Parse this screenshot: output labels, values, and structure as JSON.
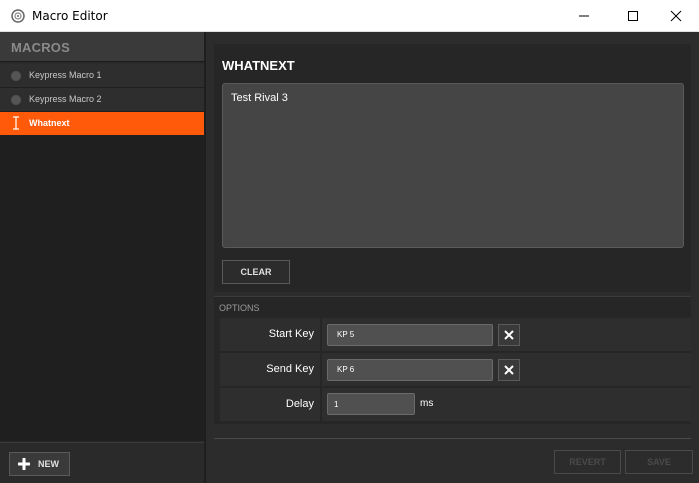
{
  "window": {
    "title": "Macro Editor"
  },
  "sidebar": {
    "header": "MACROS",
    "items": [
      {
        "label": "Keypress Macro 1",
        "active": false
      },
      {
        "label": "Keypress Macro 2",
        "active": false
      },
      {
        "label": "Whatnext",
        "active": true
      }
    ],
    "new_button": "NEW"
  },
  "editor": {
    "title": "WHATNEXT",
    "content": "Test Rival 3",
    "clear_button": "CLEAR"
  },
  "options": {
    "label": "OPTIONS",
    "start_key": {
      "label": "Start Key",
      "value": "KP 5"
    },
    "send_key": {
      "label": "Send Key",
      "value": "KP 6"
    },
    "delay": {
      "label": "Delay",
      "value": "1",
      "unit": "ms"
    }
  },
  "footer": {
    "revert_button": "REVERT",
    "save_button": "SAVE"
  },
  "colors": {
    "accent": "#ff5a0a",
    "background": "#2c2c2c",
    "sidebar": "#2a2a2a"
  }
}
